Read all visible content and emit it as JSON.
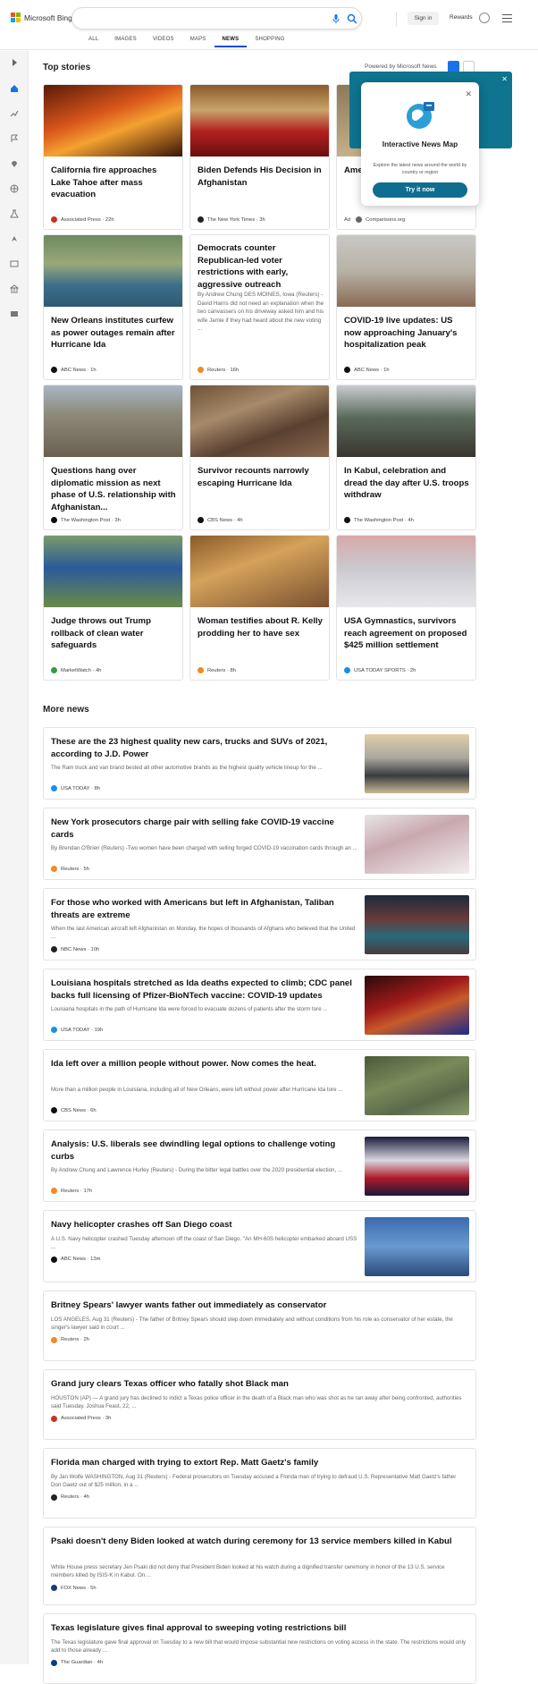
{
  "brand": {
    "name": "Microsoft Bing"
  },
  "search": {
    "placeholder": "",
    "value": ""
  },
  "header": {
    "signin": "Sign in",
    "rewards": "Rewards"
  },
  "nav": [
    "ALL",
    "IMAGES",
    "VIDEOS",
    "MAPS",
    "NEWS",
    "SHOPPING"
  ],
  "nav_active": "NEWS",
  "top": {
    "title": "Top stories",
    "powered": "Powered by Microsoft News"
  },
  "popup": {
    "title": "Interactive News Map",
    "desc": "Explore the latest news around the world by country or region",
    "button": "Try it now"
  },
  "cards": [
    {
      "title": "California fire approaches Lake Tahoe after mass evacuation",
      "source": "Associated Press · 22h",
      "icon": "ap-icon",
      "color": "#c8331f"
    },
    {
      "title": "Biden Defends His Decision in Afghanistan",
      "source": "The New York Times · 3h",
      "icon": "nyt-icon",
      "color": "#222"
    },
    {
      "title": "Amer Cred Treat",
      "source": "Comparisons.org",
      "ad": "Ad",
      "icon": "ad-icon",
      "color": "#666"
    },
    {
      "title": "New Orleans institutes curfew as power outages remain after Hurricane Ida",
      "source": "ABC News · 1h",
      "icon": "abc-icon",
      "color": "#111"
    },
    {
      "title": "Democrats counter Republican-led voter restrictions with early, aggressive outreach",
      "abstract": "By Andrew Chung DES MOINES, Iowa (Reuters) - David Harris did not need an explanation when the two canvassers on his driveway asked him and his wife Jamie if they had heard about the new voting ...",
      "source": "Reuters · 16h",
      "icon": "reuters-icon",
      "color": "#f08a24"
    },
    {
      "title": "COVID-19 live updates: US now approaching January's hospitalization peak",
      "source": "ABC News · 1h",
      "icon": "abc-icon",
      "color": "#111"
    },
    {
      "title": "Questions hang over diplomatic mission as next phase of U.S. relationship with Afghanistan...",
      "source": "The Washington Post · 3h",
      "icon": "wapo-icon",
      "color": "#111"
    },
    {
      "title": "Survivor recounts narrowly escaping Hurricane Ida",
      "source": "CBS News · 4h",
      "icon": "cbs-icon",
      "color": "#111"
    },
    {
      "title": "In Kabul, celebration and dread the day after U.S. troops withdraw",
      "source": "The Washington Post · 4h",
      "icon": "wapo-icon",
      "color": "#111"
    },
    {
      "title": "Judge throws out Trump rollback of clean water safeguards",
      "source": "MarketWatch · 4h",
      "icon": "marketwatch-icon",
      "color": "#3a9b45"
    },
    {
      "title": "Woman testifies about R. Kelly prodding her to have sex",
      "source": "Reuters · 8h",
      "icon": "reuters-icon",
      "color": "#f08a24"
    },
    {
      "title": "USA Gymnastics, survivors reach agreement on proposed $425 million settlement",
      "source": "USA TODAY SPORTS · 2h",
      "icon": "usatoday-icon",
      "color": "#1a8ee6"
    }
  ],
  "more": {
    "title": "More news"
  },
  "list": [
    {
      "title": "These are the 23 highest quality new cars, trucks and SUVs of 2021, according to J.D. Power",
      "desc": "The Ram truck and van brand bested all other automotive brands as the highest quality vehicle lineup for the ...",
      "source": "USA TODAY · 8h",
      "color": "#1a8ee6",
      "img": true
    },
    {
      "title": "New York prosecutors charge pair with selling fake COVID-19 vaccine cards",
      "desc": "By Brendan O'Brien (Reuters) -Two women have been charged with selling forged COVID-19 vaccination cards through an ...",
      "source": "Reuters · 5h",
      "color": "#f08a24",
      "img": true
    },
    {
      "title": "For those who worked with Americans but left in Afghanistan, Taliban threats are extreme",
      "desc": "When the last American aircraft left Afghanistan on Monday, the hopes of thousands of Afghans who believed that the United ...",
      "source": "NBC News · 10h",
      "color": "#222",
      "img": true
    },
    {
      "title": "Louisiana hospitals stretched as Ida deaths expected to climb; CDC panel backs full licensing of Pfizer-BioNTech vaccine: COVID-19 updates",
      "desc": "Louisiana hospitals in the path of Hurricane Ida were forced to evacuate dozens of patients after the storm tore ...",
      "source": "USA TODAY · 19h",
      "color": "#1a8ee6",
      "img": true
    },
    {
      "title": "Ida left over a million people without power. Now comes the heat.",
      "desc": "More than a million people in Louisiana, including all of New Orleans, were left without power after Hurricane Ida tore ...",
      "source": "CBS News · 6h",
      "color": "#111",
      "img": true
    },
    {
      "title": "Analysis: U.S. liberals see dwindling legal options to challenge voting curbs",
      "desc": "By Andrew Chung and Lawrence Hurley (Reuters) - During the bitter legal battles over the 2020 presidential election, ...",
      "source": "Reuters · 17h",
      "color": "#f08a24",
      "img": true
    },
    {
      "title": "Navy helicopter crashes off San Diego coast",
      "desc": "A U.S. Navy helicopter crashed Tuesday afternoon off the coast of San Diego. \"An MH-60S helicopter embarked aboard USS ...",
      "source": "ABC News · 13m",
      "color": "#111",
      "img": true
    },
    {
      "title": "Britney Spears' lawyer wants father out immediately as conservator",
      "desc": "LOS ANGELES, Aug 31 (Reuters) - The father of Britney Spears should step down immediately and without conditions from his role as conservator of her estate, the singer's lawyer said in court ...",
      "source": "Reuters · 2h",
      "color": "#f08a24",
      "img": false
    },
    {
      "title": "Grand jury clears Texas officer who fatally shot Black man",
      "desc": "HOUSTON (AP) — A grand jury has declined to indict a Texas police officer in the death of a Black man who was shot as he ran away after being confronted, authorities said Tuesday. Joshua Feast, 22, ...",
      "source": "Associated Press · 3h",
      "color": "#c8331f",
      "img": false
    },
    {
      "title": "Florida man charged with trying to extort Rep. Matt Gaetz's family",
      "desc": "By Jan Wolfe WASHINGTON, Aug 31 (Reuters) - Federal prosecutors on Tuesday accused a Florida man of trying to defraud U.S. Representative Matt Gaetz's father Don Gaetz out of $25 million, in a ...",
      "source": "Reuters · 4h",
      "color": "#222",
      "img": false
    },
    {
      "title": "Psaki doesn't deny Biden looked at watch during ceremony for 13 service members killed in Kabul",
      "desc": "White House press secretary Jen Psaki did not deny that President Biden looked at his watch during a dignified transfer ceremony in honor of the 13 U.S. service members killed by ISIS-K in Kabul. On ...",
      "source": "FOX News · 5h",
      "color": "#1a3a7a",
      "img": false
    },
    {
      "title": "Texas legislature gives final approval to sweeping voting restrictions bill",
      "desc": "The Texas legislature gave final approval on Tuesday to a new bill that would impose substantial new restrictions on voting access in the state. The restrictions would only add to those already ...",
      "source": "The Guardian · 4h",
      "color": "#0b3c7d",
      "img": false
    }
  ]
}
